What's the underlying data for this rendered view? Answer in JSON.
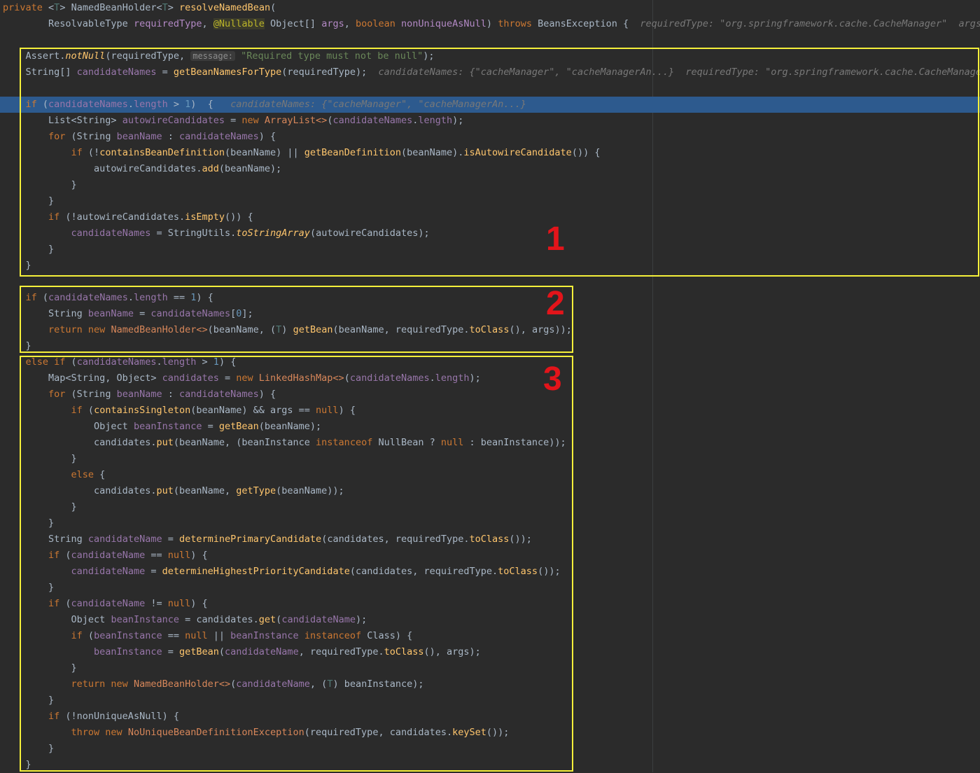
{
  "window": {
    "type": "code-editor",
    "language": "Java"
  },
  "code_lines": [
    [
      [
        "private ",
        "kw"
      ],
      [
        "<",
        "pu"
      ],
      [
        "T",
        "tp"
      ],
      [
        "> ",
        "pu"
      ],
      [
        "NamedBeanHolder",
        "ty"
      ],
      [
        "<",
        "pu"
      ],
      [
        "T",
        "tp"
      ],
      [
        "> ",
        "pu"
      ],
      [
        "resolveNamedBean",
        "fn"
      ],
      [
        "(",
        "pu"
      ]
    ],
    [
      [
        "        ResolvableType ",
        "ty"
      ],
      [
        "requiredType",
        "pm"
      ],
      [
        ", ",
        "pu"
      ],
      [
        "@Nullable",
        "an"
      ],
      [
        " Object[] ",
        "ty"
      ],
      [
        "args",
        "pm"
      ],
      [
        ", ",
        "pu"
      ],
      [
        "boolean ",
        "kw"
      ],
      [
        "nonUniqueAsNull",
        "pm"
      ],
      [
        ") ",
        "pu"
      ],
      [
        "throws ",
        "kw"
      ],
      [
        "BeansException ",
        "ty"
      ],
      [
        "{  ",
        "pu"
      ],
      [
        "requiredType: \"org.springframework.cache.CacheManager\"  args: n",
        "hint"
      ]
    ],
    [],
    [
      [
        "    Assert.",
        "ty"
      ],
      [
        "notNull",
        "fn it"
      ],
      [
        "(requiredType, ",
        "pu"
      ],
      [
        "message:",
        "hintbox"
      ],
      [
        " \"Required type must not be null\"",
        "st"
      ],
      [
        ");",
        "pu"
      ]
    ],
    [
      [
        "    String[] ",
        "ty"
      ],
      [
        "candidateNames",
        "vr"
      ],
      [
        " = ",
        "pu"
      ],
      [
        "getBeanNamesForType",
        "fn"
      ],
      [
        "(requiredType);  ",
        "pu"
      ],
      [
        "candidateNames: {\"cacheManager\", \"cacheManagerAn...}  requiredType: \"org.springframework.cache.CacheManager\"",
        "hint"
      ]
    ],
    [],
    [
      [
        "    if ",
        "kw"
      ],
      [
        "(",
        "pu"
      ],
      [
        "candidateNames",
        "vr"
      ],
      [
        ".",
        "pu"
      ],
      [
        "length",
        "vr"
      ],
      [
        " > ",
        "pu"
      ],
      [
        "1",
        "nu"
      ],
      [
        ")  {   ",
        "pu"
      ],
      [
        "candidateNames: {\"cacheManager\", \"cacheManagerAn...}",
        "hint"
      ]
    ],
    [
      [
        "        List<String> ",
        "ty"
      ],
      [
        "autowireCandidates",
        "vr"
      ],
      [
        " = ",
        "pu"
      ],
      [
        "new ",
        "kw"
      ],
      [
        "ArrayList<>",
        "cls"
      ],
      [
        "(",
        "pu"
      ],
      [
        "candidateNames",
        "vr"
      ],
      [
        ".",
        "pu"
      ],
      [
        "length",
        "vr"
      ],
      [
        ");",
        "pu"
      ]
    ],
    [
      [
        "        for ",
        "kw"
      ],
      [
        "(String ",
        "ty"
      ],
      [
        "beanName",
        "vr"
      ],
      [
        " : ",
        "pu"
      ],
      [
        "candidateNames",
        "vr"
      ],
      [
        ") {",
        "pu"
      ]
    ],
    [
      [
        "            if ",
        "kw"
      ],
      [
        "(!",
        "pu"
      ],
      [
        "containsBeanDefinition",
        "fn"
      ],
      [
        "(beanName) || ",
        "pu"
      ],
      [
        "getBeanDefinition",
        "fn"
      ],
      [
        "(beanName).",
        "pu"
      ],
      [
        "isAutowireCandidate",
        "fn"
      ],
      [
        "()) {",
        "pu"
      ]
    ],
    [
      [
        "                autowireCandidates.",
        "ty"
      ],
      [
        "add",
        "fn"
      ],
      [
        "(beanName);",
        "pu"
      ]
    ],
    [
      [
        "            }",
        "pu"
      ]
    ],
    [
      [
        "        }",
        "pu"
      ]
    ],
    [
      [
        "        if ",
        "kw"
      ],
      [
        "(!",
        "pu"
      ],
      [
        "autowireCandidates.",
        "ty"
      ],
      [
        "isEmpty",
        "fn"
      ],
      [
        "()) {",
        "pu"
      ]
    ],
    [
      [
        "            ",
        "pu"
      ],
      [
        "candidateNames",
        "vr"
      ],
      [
        " = StringUtils.",
        "ty"
      ],
      [
        "toStringArray",
        "fn it"
      ],
      [
        "(autowireCandidates);",
        "pu"
      ]
    ],
    [
      [
        "        }",
        "pu"
      ]
    ],
    [
      [
        "    }",
        "pu"
      ]
    ],
    [],
    [
      [
        "    if ",
        "kw"
      ],
      [
        "(",
        "pu"
      ],
      [
        "candidateNames",
        "vr"
      ],
      [
        ".",
        "pu"
      ],
      [
        "length",
        "vr"
      ],
      [
        " == ",
        "pu"
      ],
      [
        "1",
        "nu"
      ],
      [
        ") {",
        "pu"
      ]
    ],
    [
      [
        "        String ",
        "ty"
      ],
      [
        "beanName",
        "vr"
      ],
      [
        " = ",
        "pu"
      ],
      [
        "candidateNames",
        "vr"
      ],
      [
        "[",
        "pu"
      ],
      [
        "0",
        "nu"
      ],
      [
        "];",
        "pu"
      ]
    ],
    [
      [
        "        return new ",
        "kw"
      ],
      [
        "NamedBeanHolder<>",
        "cls"
      ],
      [
        "(beanName, (",
        "pu"
      ],
      [
        "T",
        "tp"
      ],
      [
        ") ",
        "pu"
      ],
      [
        "getBean",
        "fn"
      ],
      [
        "(beanName, requiredType.",
        "pu"
      ],
      [
        "toClass",
        "fn"
      ],
      [
        "(), args));",
        "pu"
      ]
    ],
    [
      [
        "    }",
        "pu"
      ]
    ],
    [
      [
        "    else if ",
        "kw"
      ],
      [
        "(",
        "pu"
      ],
      [
        "candidateNames",
        "vr"
      ],
      [
        ".",
        "pu"
      ],
      [
        "length",
        "vr"
      ],
      [
        " > ",
        "pu"
      ],
      [
        "1",
        "nu"
      ],
      [
        ") {",
        "pu"
      ]
    ],
    [
      [
        "        Map<String, Object> ",
        "ty"
      ],
      [
        "candidates",
        "vr"
      ],
      [
        " = ",
        "pu"
      ],
      [
        "new ",
        "kw"
      ],
      [
        "LinkedHashMap<>",
        "cls"
      ],
      [
        "(",
        "pu"
      ],
      [
        "candidateNames",
        "vr"
      ],
      [
        ".",
        "pu"
      ],
      [
        "length",
        "vr"
      ],
      [
        ");",
        "pu"
      ]
    ],
    [
      [
        "        for ",
        "kw"
      ],
      [
        "(String ",
        "ty"
      ],
      [
        "beanName",
        "vr"
      ],
      [
        " : ",
        "pu"
      ],
      [
        "candidateNames",
        "vr"
      ],
      [
        ") {",
        "pu"
      ]
    ],
    [
      [
        "            if ",
        "kw"
      ],
      [
        "(",
        "pu"
      ],
      [
        "containsSingleton",
        "fn"
      ],
      [
        "(beanName) && args == ",
        "pu"
      ],
      [
        "null",
        "kw"
      ],
      [
        ") {",
        "pu"
      ]
    ],
    [
      [
        "                Object ",
        "ty"
      ],
      [
        "beanInstance",
        "vr"
      ],
      [
        " = ",
        "pu"
      ],
      [
        "getBean",
        "fn"
      ],
      [
        "(beanName);",
        "pu"
      ]
    ],
    [
      [
        "                candidates.",
        "ty"
      ],
      [
        "put",
        "fn"
      ],
      [
        "(beanName, (beanInstance ",
        "pu"
      ],
      [
        "instanceof ",
        "kw"
      ],
      [
        "NullBean ? ",
        "ty"
      ],
      [
        "null",
        "kw"
      ],
      [
        " : beanInstance));",
        "pu"
      ]
    ],
    [
      [
        "            }",
        "pu"
      ]
    ],
    [
      [
        "            else ",
        "kw"
      ],
      [
        "{",
        "pu"
      ]
    ],
    [
      [
        "                candidates.",
        "ty"
      ],
      [
        "put",
        "fn"
      ],
      [
        "(beanName, ",
        "pu"
      ],
      [
        "getType",
        "fn"
      ],
      [
        "(beanName));",
        "pu"
      ]
    ],
    [
      [
        "            }",
        "pu"
      ]
    ],
    [
      [
        "        }",
        "pu"
      ]
    ],
    [
      [
        "        String ",
        "ty"
      ],
      [
        "candidateName",
        "vr"
      ],
      [
        " = ",
        "pu"
      ],
      [
        "determinePrimaryCandidate",
        "fn"
      ],
      [
        "(candidates, requiredType.",
        "pu"
      ],
      [
        "toClass",
        "fn"
      ],
      [
        "());",
        "pu"
      ]
    ],
    [
      [
        "        if ",
        "kw"
      ],
      [
        "(",
        "pu"
      ],
      [
        "candidateName",
        "vr"
      ],
      [
        " == ",
        "pu"
      ],
      [
        "null",
        "kw"
      ],
      [
        ") {",
        "pu"
      ]
    ],
    [
      [
        "            ",
        "pu"
      ],
      [
        "candidateName",
        "vr"
      ],
      [
        " = ",
        "pu"
      ],
      [
        "determineHighestPriorityCandidate",
        "fn"
      ],
      [
        "(candidates, requiredType.",
        "pu"
      ],
      [
        "toClass",
        "fn"
      ],
      [
        "());",
        "pu"
      ]
    ],
    [
      [
        "        }",
        "pu"
      ]
    ],
    [
      [
        "        if ",
        "kw"
      ],
      [
        "(",
        "pu"
      ],
      [
        "candidateName",
        "vr"
      ],
      [
        " != ",
        "pu"
      ],
      [
        "null",
        "kw"
      ],
      [
        ") {",
        "pu"
      ]
    ],
    [
      [
        "            Object ",
        "ty"
      ],
      [
        "beanInstance",
        "vr"
      ],
      [
        " = candidates.",
        "pu"
      ],
      [
        "get",
        "fn"
      ],
      [
        "(",
        "pu"
      ],
      [
        "candidateName",
        "vr"
      ],
      [
        ");",
        "pu"
      ]
    ],
    [
      [
        "            if ",
        "kw"
      ],
      [
        "(",
        "pu"
      ],
      [
        "beanInstance",
        "vr"
      ],
      [
        " == ",
        "pu"
      ],
      [
        "null",
        "kw"
      ],
      [
        " || ",
        "pu"
      ],
      [
        "beanInstance ",
        "vr"
      ],
      [
        "instanceof ",
        "kw"
      ],
      [
        "Class) {",
        "ty"
      ]
    ],
    [
      [
        "                ",
        "pu"
      ],
      [
        "beanInstance",
        "vr"
      ],
      [
        " = ",
        "pu"
      ],
      [
        "getBean",
        "fn"
      ],
      [
        "(",
        "pu"
      ],
      [
        "candidateName",
        "vr"
      ],
      [
        ", requiredType.",
        "pu"
      ],
      [
        "toClass",
        "fn"
      ],
      [
        "(), args);",
        "pu"
      ]
    ],
    [
      [
        "            }",
        "pu"
      ]
    ],
    [
      [
        "            return new ",
        "kw"
      ],
      [
        "NamedBeanHolder<>",
        "cls"
      ],
      [
        "(",
        "pu"
      ],
      [
        "candidateName",
        "vr"
      ],
      [
        ", (",
        "pu"
      ],
      [
        "T",
        "tp"
      ],
      [
        ") beanInstance);",
        "pu"
      ]
    ],
    [
      [
        "        }",
        "pu"
      ]
    ],
    [
      [
        "        if ",
        "kw"
      ],
      [
        "(!nonUniqueAsNull) {",
        "pu"
      ]
    ],
    [
      [
        "            throw new ",
        "kw"
      ],
      [
        "NoUniqueBeanDefinitionException",
        "cls"
      ],
      [
        "(requiredType, candidates.",
        "pu"
      ],
      [
        "keySet",
        "fn"
      ],
      [
        "());",
        "pu"
      ]
    ],
    [
      [
        "        }",
        "pu"
      ]
    ],
    [
      [
        "    }",
        "pu"
      ]
    ]
  ],
  "current_line_index": 6,
  "box_labels": [
    "1",
    "2",
    "3"
  ],
  "colors": {
    "box_border": "#f5f03a",
    "box_label": "#e3141a",
    "current_line": "#2d5a8e",
    "background": "#2b2b2b"
  }
}
